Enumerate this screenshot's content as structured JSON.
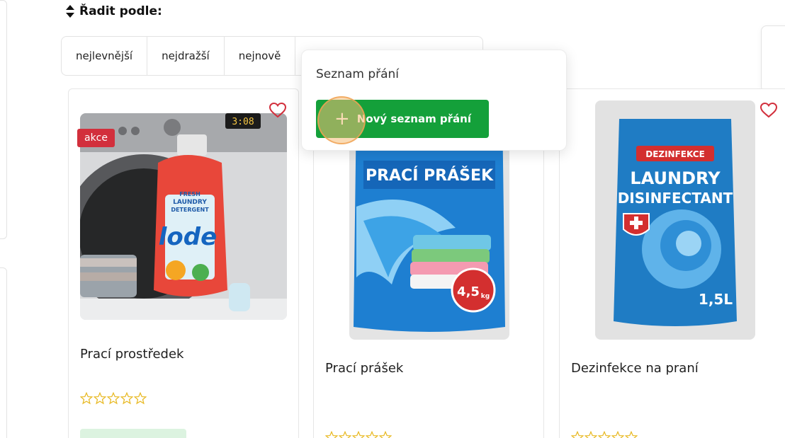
{
  "sort": {
    "heading": "Řadit podle:",
    "tabs": [
      "nejlevnější",
      "nejdražší",
      "nejnově",
      ""
    ]
  },
  "wishlist_popup": {
    "title": "Seznam přání",
    "new_button_label": "Nový seznam přání"
  },
  "products": [
    {
      "title": "Prací prostředek",
      "badge": "akce",
      "rating": 0,
      "stock_badge": "",
      "image_text": [
        "FRESH",
        "LAUNDRY",
        "DETERGENT",
        "lode",
        "3:08"
      ]
    },
    {
      "title": "Prací prášek",
      "rating": 0,
      "image_text": [
        "PRACÍ PRÁŠEK",
        "4,5",
        "kg"
      ]
    },
    {
      "title": "Dezinfekce na praní",
      "rating": 0,
      "image_text": [
        "DEZINFEKCE",
        "LAUNDRY",
        "DISINFECTANT",
        "1,5L"
      ]
    }
  ],
  "colors": {
    "accent_green": "#14a03a",
    "sale_red": "#d22f3c",
    "star_gold": "#e8b923",
    "heart_red": "#d22f3c"
  },
  "icons": {
    "sort": "sort-icon",
    "wishlist": "heart-outline-icon",
    "add": "plus-icon",
    "rating": "star-outline-icon"
  }
}
